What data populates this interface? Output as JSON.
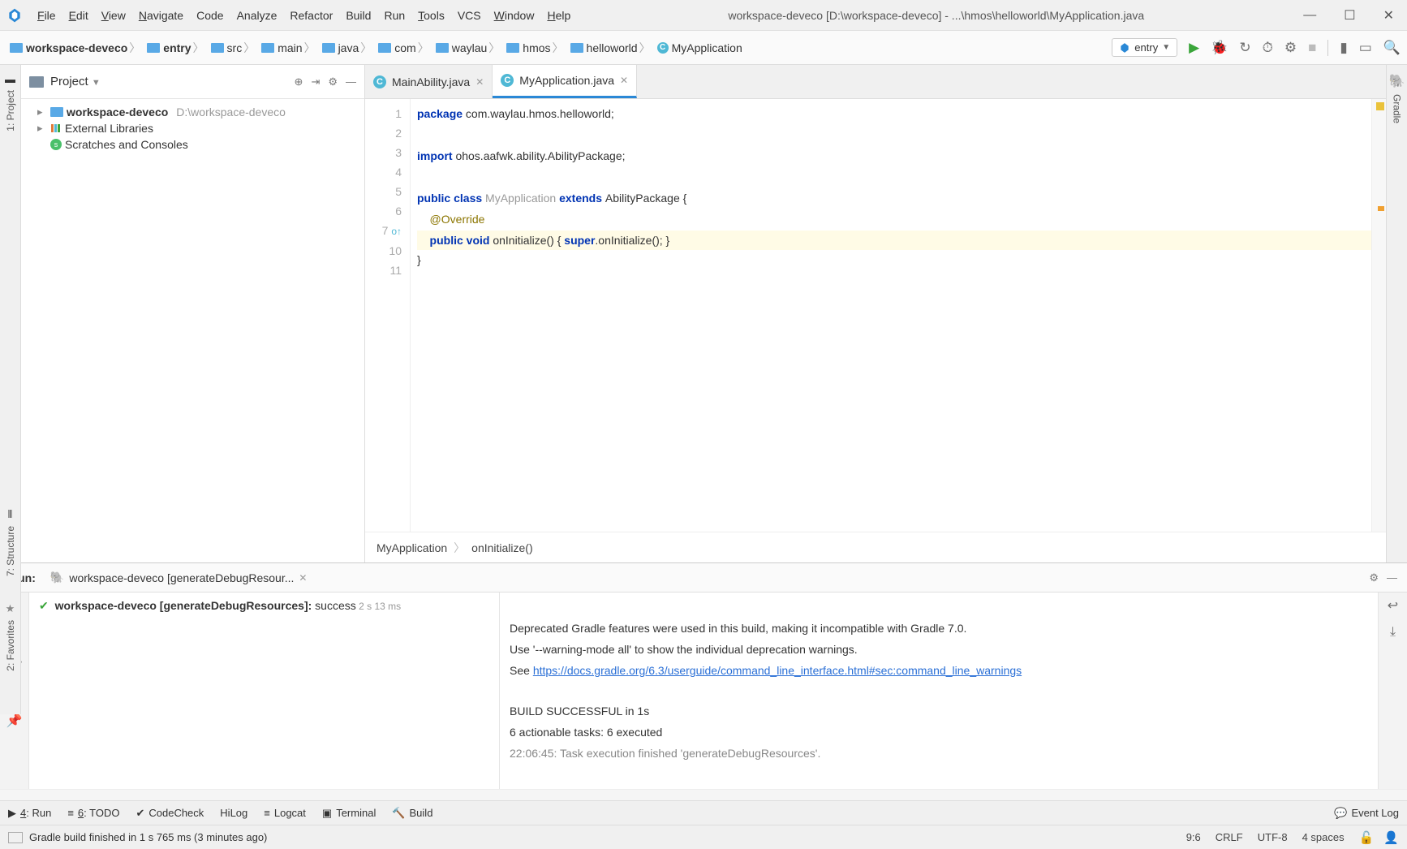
{
  "menu": {
    "file": "File",
    "edit": "Edit",
    "view": "View",
    "navigate": "Navigate",
    "code": "Code",
    "analyze": "Analyze",
    "refactor": "Refactor",
    "build": "Build",
    "run": "Run",
    "tools": "Tools",
    "vcs": "VCS",
    "window": "Window",
    "help": "Help"
  },
  "window_title": "workspace-deveco [D:\\workspace-deveco] - ...\\hmos\\helloworld\\MyApplication.java",
  "breadcrumbs": {
    "b0": "workspace-deveco",
    "b1": "entry",
    "b2": "src",
    "b3": "main",
    "b4": "java",
    "b5": "com",
    "b6": "waylau",
    "b7": "hmos",
    "b8": "helloworld",
    "b9": "MyApplication"
  },
  "run_config": "entry",
  "project": {
    "title": "Project",
    "root": "workspace-deveco",
    "root_path": "D:\\workspace-deveco",
    "libs": "External Libraries",
    "scratches": "Scratches and Consoles"
  },
  "tabs": {
    "t0": "MainAbility.java",
    "t1": "MyApplication.java"
  },
  "code": {
    "l1a": "package",
    "l1b": " com.waylau.hmos.helloworld;",
    "l3a": "import",
    "l3b": " ohos.aafwk.ability.AbilityPackage;",
    "l5a": "public class ",
    "l5b": "MyApplication",
    "l5c": " extends ",
    "l5d": "AbilityPackage {",
    "l6": "    @Override",
    "l7a": "    public void ",
    "l7b": "onInitialize() { ",
    "l7c": "super",
    "l7d": ".onInitialize(); }",
    "l10": "}"
  },
  "gutter": {
    "n1": "1",
    "n2": "2",
    "n3": "3",
    "n4": "4",
    "n5": "5",
    "n6": "6",
    "n7": "7",
    "n10": "10",
    "n11": "11"
  },
  "crumbbar": {
    "c0": "MyApplication",
    "c1": "onInitialize()"
  },
  "run": {
    "label": "Run:",
    "tab": "workspace-deveco [generateDebugResour...",
    "task_name": "workspace-deveco [generateDebugResources]:",
    "task_status": " success",
    "task_time": " 2 s 13 ms",
    "out1": "Deprecated Gradle features were used in this build, making it incompatible with Gradle 7.0.",
    "out2": "Use '--warning-mode all' to show the individual deprecation warnings.",
    "out3": "See ",
    "out3_link": "https://docs.gradle.org/6.3/userguide/command_line_interface.html#sec:command_line_warnings",
    "out5": "BUILD SUCCESSFUL in 1s",
    "out6": "6 actionable tasks: 6 executed",
    "out7": "22:06:45: Task execution finished 'generateDebugResources'."
  },
  "bottom": {
    "run": "4: Run",
    "todo": "6: TODO",
    "codecheck": "CodeCheck",
    "hilog": "HiLog",
    "logcat": "Logcat",
    "terminal": "Terminal",
    "build": "Build",
    "event": "Event Log"
  },
  "status": {
    "msg": "Gradle build finished in 1 s 765 ms (3 minutes ago)",
    "pos": "9:6",
    "eol": "CRLF",
    "enc": "UTF-8",
    "indent": "4 spaces"
  },
  "side": {
    "project": "1: Project",
    "structure": "7: Structure",
    "favorites": "2: Favorites",
    "gradle": "Gradle"
  }
}
